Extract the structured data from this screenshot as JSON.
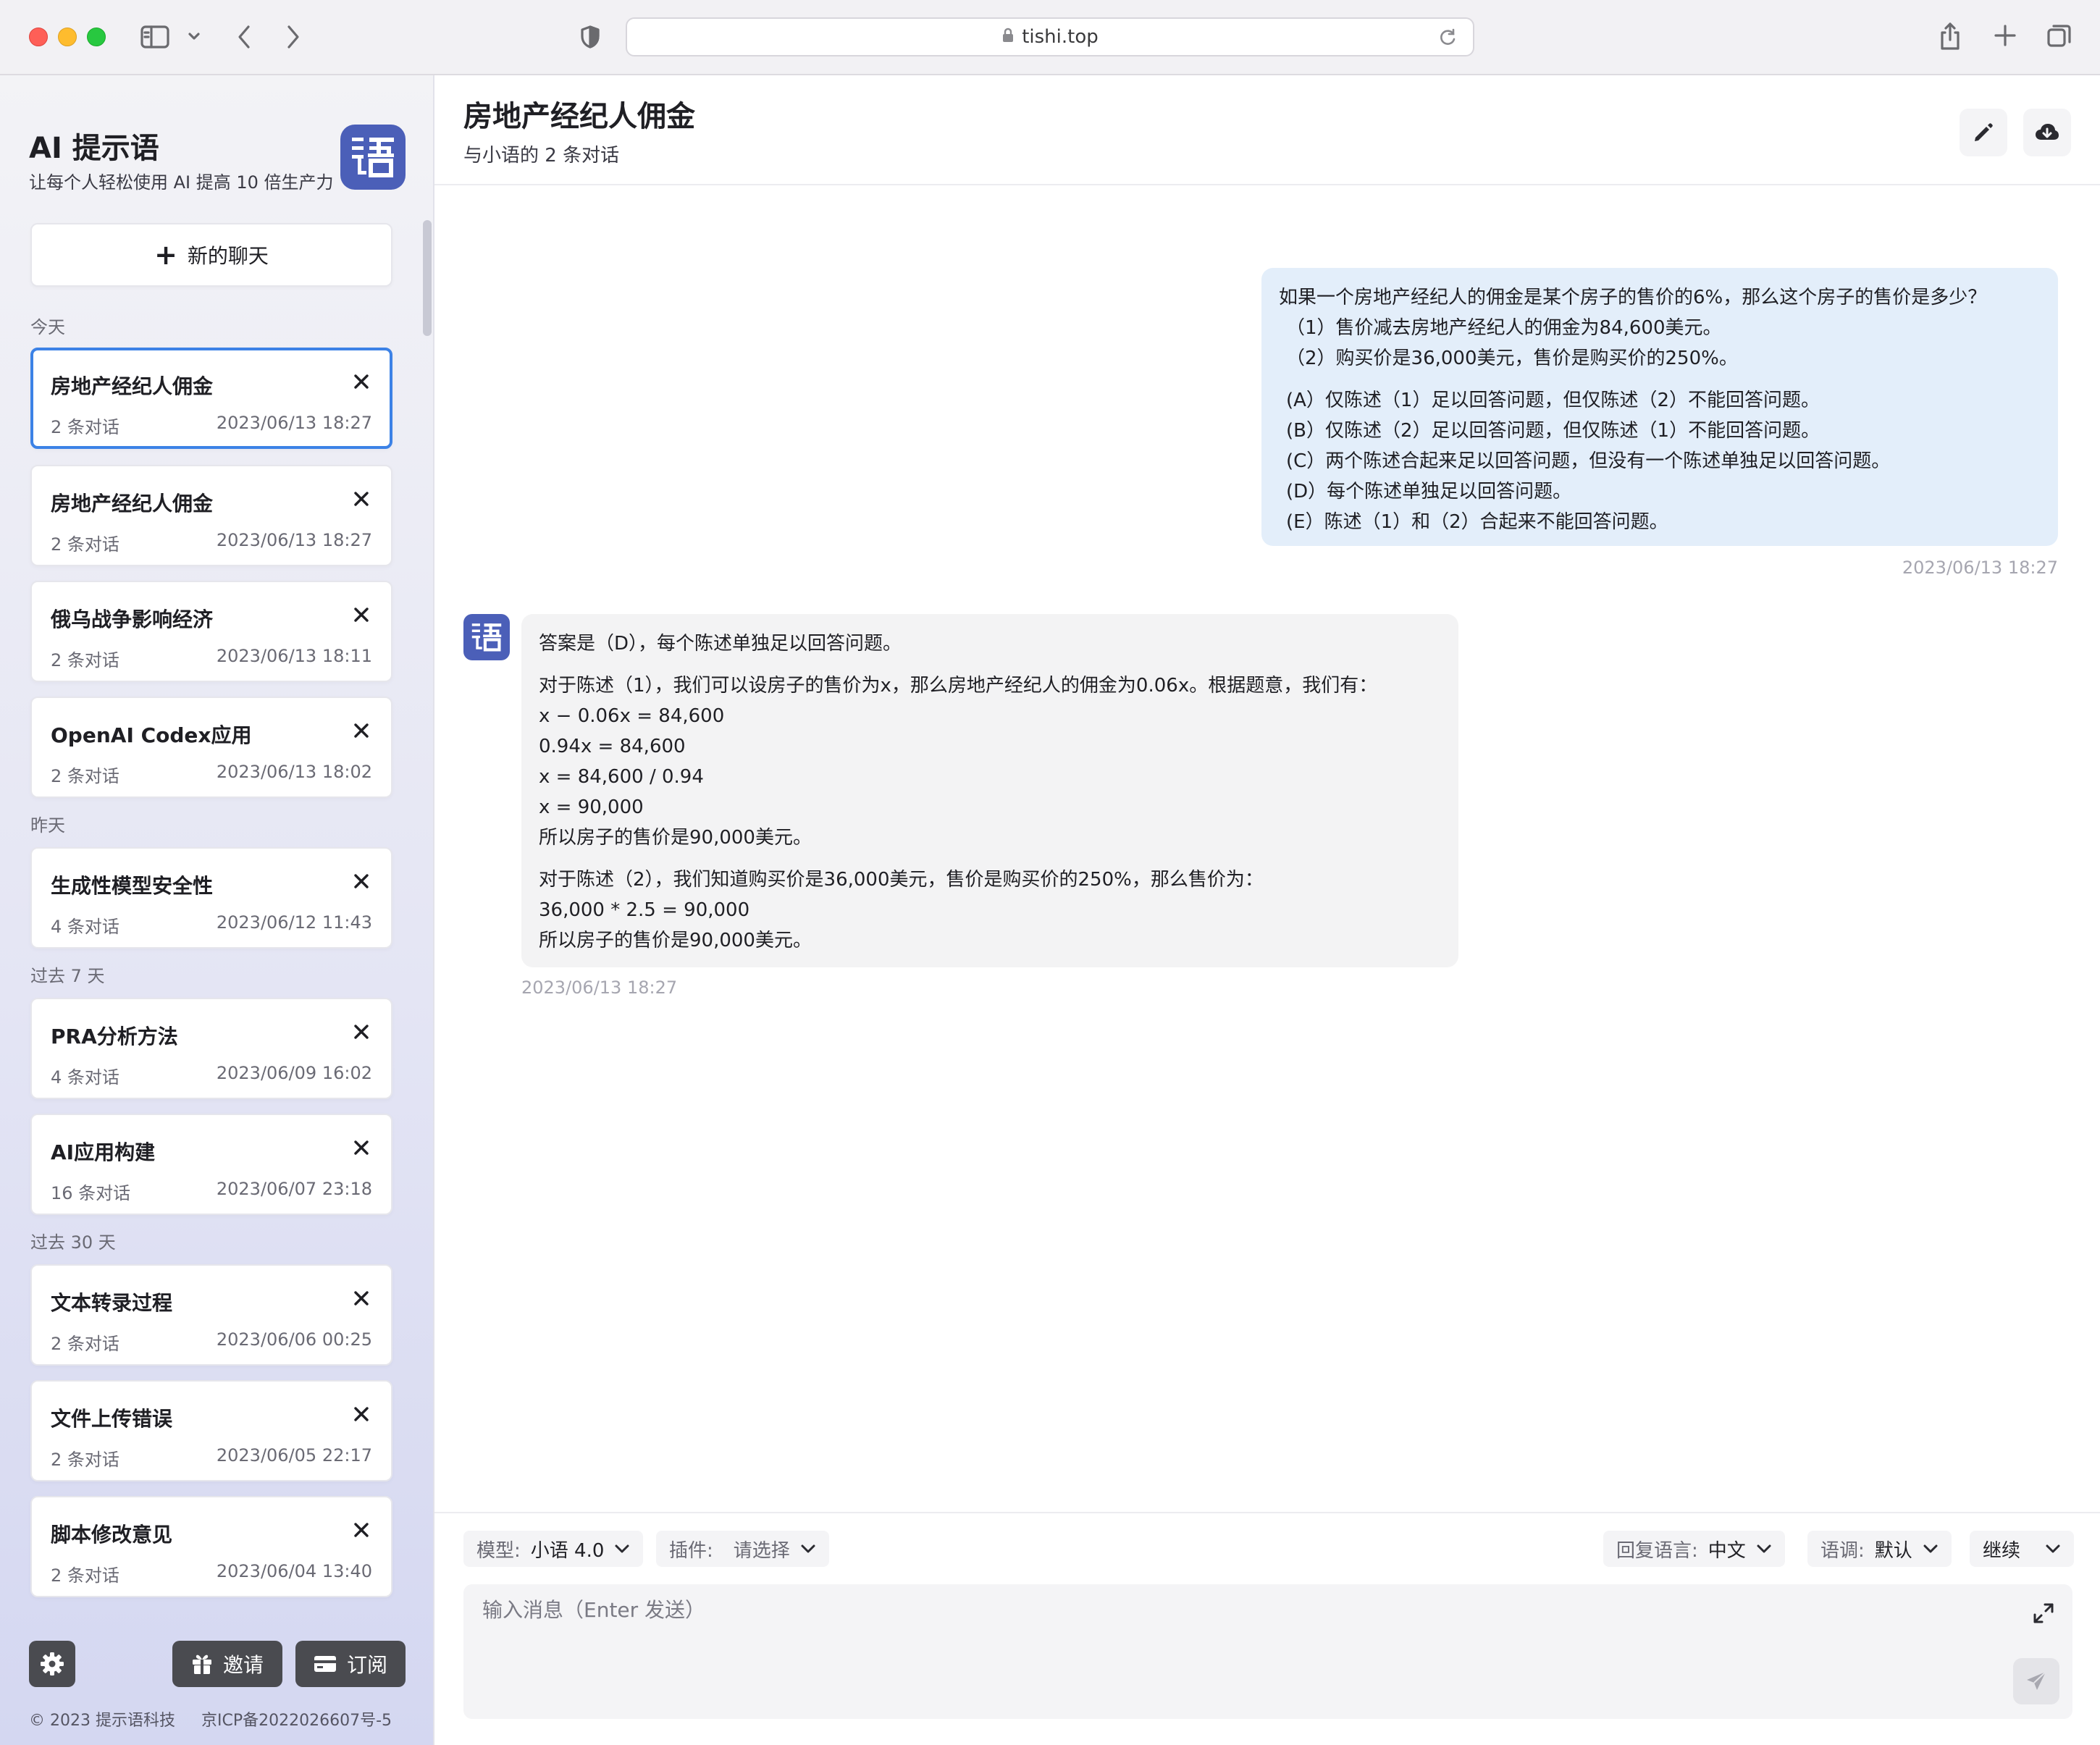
{
  "browser": {
    "url": "tishi.top"
  },
  "sidebar": {
    "brand_title": "AI 提示语",
    "brand_subtitle": "让每个人轻松使用 AI 提高 10 倍生产力",
    "new_chat_label": "新的聊天",
    "groups": [
      {
        "label": "今天"
      },
      {
        "label": "昨天"
      },
      {
        "label": "过去 7 天"
      },
      {
        "label": "过去 30 天"
      }
    ],
    "chats": [
      {
        "title": "房地产经纪人佣金",
        "count": "2 条对话",
        "time": "2023/06/13 18:27",
        "active": true
      },
      {
        "title": "房地产经纪人佣金",
        "count": "2 条对话",
        "time": "2023/06/13 18:27"
      },
      {
        "title": "俄乌战争影响经济",
        "count": "2 条对话",
        "time": "2023/06/13 18:11"
      },
      {
        "title": "OpenAI Codex应用",
        "count": "2 条对话",
        "time": "2023/06/13 18:02"
      },
      {
        "title": "生成性模型安全性",
        "count": "4 条对话",
        "time": "2023/06/12 11:43"
      },
      {
        "title": "PRA分析方法",
        "count": "4 条对话",
        "time": "2023/06/09 16:02"
      },
      {
        "title": "AI应用构建",
        "count": "16 条对话",
        "time": "2023/06/07 23:18"
      },
      {
        "title": "文本转录过程",
        "count": "2 条对话",
        "time": "2023/06/06 00:25"
      },
      {
        "title": "文件上传错误",
        "count": "2 条对话",
        "time": "2023/06/05 22:17"
      },
      {
        "title": "脚本修改意见",
        "count": "2 条对话",
        "time": "2023/06/04 13:40"
      }
    ],
    "invite_label": "邀请",
    "subscribe_label": "订阅",
    "footer_copyright": "© 2023 提示语科技",
    "footer_icp": "京ICP备2022026607号-5"
  },
  "main": {
    "title": "房地产经纪人佣金",
    "subtitle": "与小语的 2 条对话",
    "user_message": {
      "lines": [
        "如果一个房地产经纪人的佣金是某个房子的售价的6%，那么这个房子的售价是多少？",
        "（1）售价减去房地产经纪人的佣金为84,600美元。",
        "（2）购买价是36,000美元，售价是购买价的250%。"
      ],
      "options": [
        "(A）仅陈述（1）足以回答问题，但仅陈述（2）不能回答问题。",
        "(B）仅陈述（2）足以回答问题，但仅陈述（1）不能回答问题。",
        "(C）两个陈述合起来足以回答问题，但没有一个陈述单独足以回答问题。",
        "(D）每个陈述单独足以回答问题。",
        "(E）陈述（1）和（2）合起来不能回答问题。"
      ],
      "time": "2023/06/13 18:27"
    },
    "bot_message": {
      "answer": "答案是（D），每个陈述单独足以回答问题。",
      "part1": [
        "对于陈述（1），我们可以设房子的售价为x，那么房地产经纪人的佣金为0.06x。根据题意，我们有：",
        "x − 0.06x = 84,600",
        "0.94x = 84,600",
        "x = 84,600 / 0.94",
        "x = 90,000",
        "所以房子的售价是90,000美元。"
      ],
      "part2": [
        "对于陈述（2），我们知道购买价是36,000美元，售价是购买价的250%，那么售价为：",
        "36,000 * 2.5 = 90,000",
        "所以房子的售价是90,000美元。"
      ],
      "time": "2023/06/13 18:27"
    },
    "controls": {
      "model_label": "模型:",
      "model_value": "小语 4.0",
      "plugin_label": "插件:",
      "plugin_value": "请选择",
      "reply_lang_label": "回复语言:",
      "reply_lang_value": "中文",
      "tone_label": "语调:",
      "tone_value": "默认",
      "continue_label": "继续"
    },
    "input": {
      "placeholder": "输入消息（Enter 发送）"
    }
  },
  "colors": {
    "accent_blue": "#3c82e6",
    "brand_indigo": "#4b5fb8",
    "user_bubble": "#e3eefa",
    "bot_bubble": "#f3f3f4"
  },
  "icons": {
    "sidebar_toggle": "sidebar-icon",
    "shield": "shield-icon",
    "lock": "lock-icon",
    "reload": "reload-icon",
    "share": "share-icon",
    "new_tab": "plus-icon",
    "tabs": "tabs-icon",
    "edit": "pencil-icon",
    "download": "cloud-download-icon",
    "settings": "gear-icon",
    "gift": "gift-icon",
    "card": "credit-card-icon",
    "expand": "expand-icon",
    "send": "send-icon",
    "close": "close-icon"
  }
}
